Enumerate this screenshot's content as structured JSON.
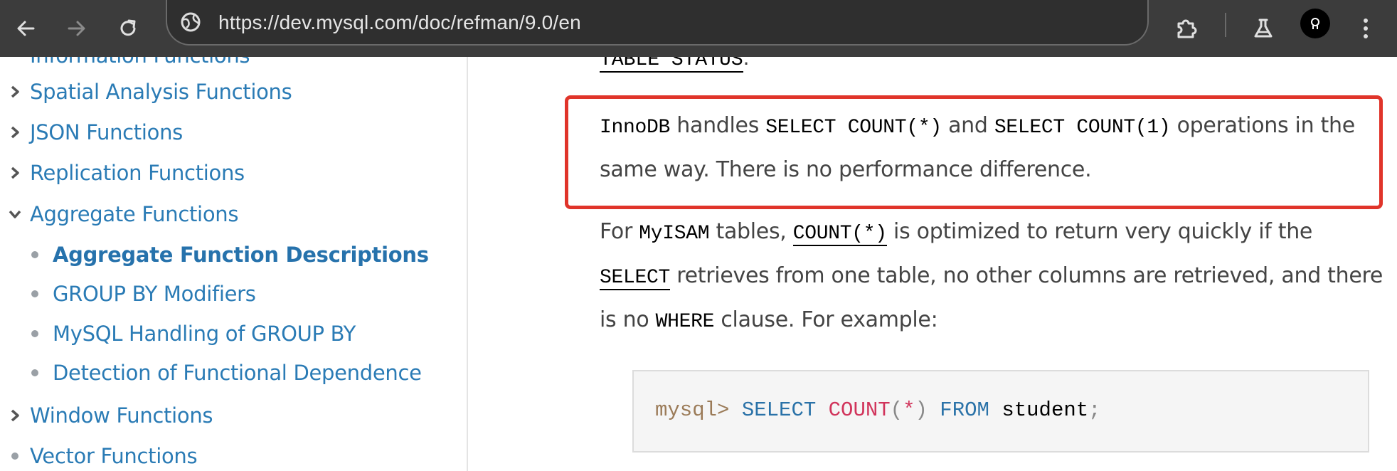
{
  "browser": {
    "url": "https://dev.mysql.com/doc/refman/9.0/en",
    "icons": {
      "back": "arrow-left-icon",
      "forward": "arrow-right-icon",
      "reload": "reload-icon",
      "site_info": "site-info-icon",
      "extensions": "puzzle-piece-icon",
      "labs": "flask-icon",
      "profile": "avatar",
      "menu": "kebab-menu-icon"
    }
  },
  "sidebar": {
    "partial_item": "Information Functions",
    "items": [
      {
        "label": "Spatial Analysis Functions",
        "state": "collapsed"
      },
      {
        "label": "JSON Functions",
        "state": "collapsed"
      },
      {
        "label": "Replication Functions",
        "state": "collapsed"
      },
      {
        "label": "Aggregate Functions",
        "state": "expanded"
      }
    ],
    "children": [
      {
        "label": "Aggregate Function Descriptions",
        "current": true
      },
      {
        "label": "GROUP BY Modifiers"
      },
      {
        "label": "MySQL Handling of GROUP BY"
      },
      {
        "label": "Detection of Functional Dependence"
      }
    ],
    "after_items": [
      {
        "label": "Window Functions",
        "state": "collapsed"
      },
      {
        "label": "Vector Functions",
        "state": "leaf"
      }
    ]
  },
  "content": {
    "top_fragment": {
      "code": "TABLE STATUS",
      "tail": "."
    },
    "highlight_para": {
      "code1": "InnoDB",
      "t1": " handles ",
      "code2": "SELECT COUNT(*)",
      "t2": " and ",
      "code3": "SELECT COUNT(1)",
      "t3": " operations in the same way. There is no performance difference."
    },
    "myisam_para": {
      "t1": "For ",
      "code1": "MyISAM",
      "t2": " tables, ",
      "link1": "COUNT(*)",
      "t3": " is optimized to return very quickly if the ",
      "link2": "SELECT",
      "t4": " retrieves from one table, no other columns are retrieved, and there is no ",
      "code2": "WHERE",
      "t5": " clause. For example:"
    },
    "code_example": {
      "prompt": "mysql>",
      "kw1": "SELECT",
      "fn": "COUNT",
      "open": "(",
      "star": "*",
      "close": ")",
      "kw2": "FROM",
      "ident": "student",
      "semi": ";"
    },
    "colors": {
      "link": "#2a7bb5",
      "highlight_border": "#e0342a",
      "keyword": "#2a72a8",
      "function": "#d1345b",
      "prompt": "#9b7b58"
    }
  }
}
